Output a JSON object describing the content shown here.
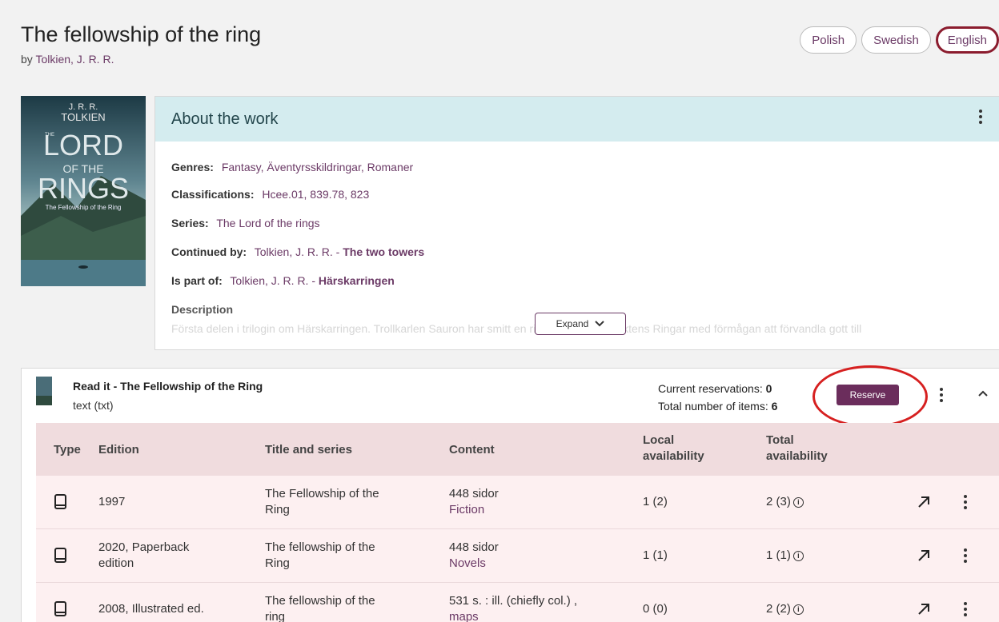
{
  "header": {
    "title": "The fellowship of the ring",
    "by_prefix": "by",
    "author": "Tolkien, J. R. R.",
    "languages": [
      {
        "label": "Polish",
        "active": false
      },
      {
        "label": "Swedish",
        "active": false
      },
      {
        "label": "English",
        "active": true
      }
    ]
  },
  "cover": {
    "author_line1": "J. R. R.",
    "author_line2": "TOLKIEN",
    "title_lord": "LORD",
    "title_the": "THE",
    "title_of_the": "OF THE",
    "title_rings": "RINGS",
    "subtitle": "The Fellowship of the Ring"
  },
  "about": {
    "heading": "About the work",
    "genres_label": "Genres:",
    "genres_value": "Fantasy, Äventyrsskildringar, Romaner",
    "classifications_label": "Classifications:",
    "classifications_value": "Hcee.01, 839.78, 823",
    "series_label": "Series:",
    "series_value": "The Lord of the rings",
    "continued_label": "Continued by:",
    "continued_author": "Tolkien, J. R. R. - ",
    "continued_title": "The two towers",
    "partof_label": "Is part of:",
    "partof_author": "Tolkien, J. R. R. - ",
    "partof_title": "Härskarringen",
    "description_label": "Description",
    "description_text": "Första delen i trilogin om Härskarringen. Trollkarlen Sauron har smitt en ring - det en av Maktens Ringar med förmågan att förvandla gott till",
    "expand_label": "Expand"
  },
  "manifestation": {
    "title": "Read it - The Fellowship of the Ring",
    "format": "text (txt)",
    "reservations_label": "Current reservations: ",
    "reservations_value": "0",
    "items_label": "Total number of items: ",
    "items_value": "6",
    "reserve_label": "Reserve",
    "columns": {
      "type": "Type",
      "edition": "Edition",
      "title": "Title and series",
      "content": "Content",
      "local_1": "Local",
      "local_2": "availability",
      "total_1": "Total",
      "total_2": "availability"
    },
    "rows": [
      {
        "edition_1": "1997",
        "edition_2": "",
        "title_1": "The Fellowship of the",
        "title_2": "Ring",
        "content_1": "448 sidor",
        "content_2": "Fiction",
        "local": "1 (2)",
        "total": "2 (3)"
      },
      {
        "edition_1": "2020, Paperback",
        "edition_2": "edition",
        "title_1": "The fellowship of the",
        "title_2": "Ring",
        "content_1": "448 sidor",
        "content_2": "Novels",
        "local": "1 (1)",
        "total": "1 (1)"
      },
      {
        "edition_1": "2008, Illustrated ed.",
        "edition_2": "",
        "title_1": "The fellowship of the",
        "title_2": "ring",
        "content_1": "531 s. : ill. (chiefly col.) ,",
        "content_2": "maps",
        "local": "0 (0)",
        "total": "2 (2)"
      }
    ]
  },
  "colors": {
    "accent": "#6b3a66",
    "about_header": "#d4ecef",
    "table_header": "#f0dcde",
    "table_row": "#fdf0f1",
    "highlight": "#d62020"
  }
}
